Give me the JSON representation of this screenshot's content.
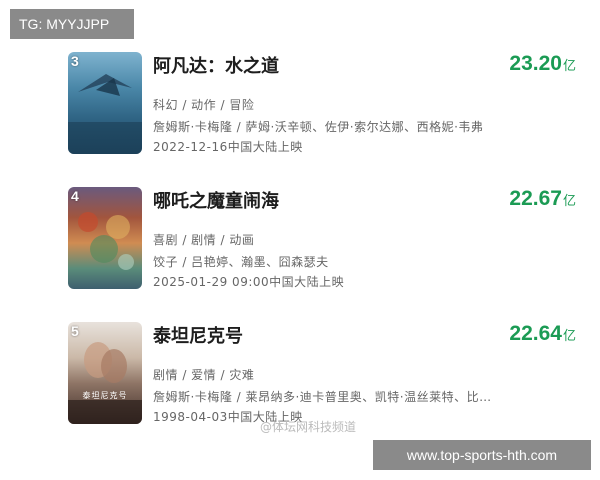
{
  "tags": {
    "top": "TG: MYYJJPP",
    "bottom": "www.top-sports-hth.com"
  },
  "watermark": "@体坛网科技频道",
  "movies": [
    {
      "rank": "3",
      "title": "阿凡达：水之道",
      "box_office": "23.20",
      "box_unit": "亿",
      "genres": "科幻 / 动作 / 冒险",
      "cast": "詹姆斯·卡梅隆 / 萨姆·沃辛顿、佐伊·索尔达娜、西格妮·韦弗",
      "release": "2022-12-16中国大陆上映"
    },
    {
      "rank": "4",
      "title": "哪吒之魔童闹海",
      "box_office": "22.67",
      "box_unit": "亿",
      "genres": "喜剧 / 剧情 / 动画",
      "cast": "饺子 / 吕艳婷、瀚墨、囧森瑟夫",
      "release": "2025-01-29 09:00中国大陆上映"
    },
    {
      "rank": "5",
      "title": "泰坦尼克号",
      "box_office": "22.64",
      "box_unit": "亿",
      "genres": "剧情 / 爱情 / 灾难",
      "cast": "詹姆斯·卡梅隆 / 莱昂纳多·迪卡普里奥、凯特·温丝莱特、比…",
      "release": "1998-04-03中国大陆上映",
      "poster_text": "泰坦尼克号"
    }
  ],
  "colors": {
    "box_office": "#1b9b54",
    "title": "#1e1e1e",
    "meta": "#666666",
    "tag_bg": "#8a8a8a"
  }
}
